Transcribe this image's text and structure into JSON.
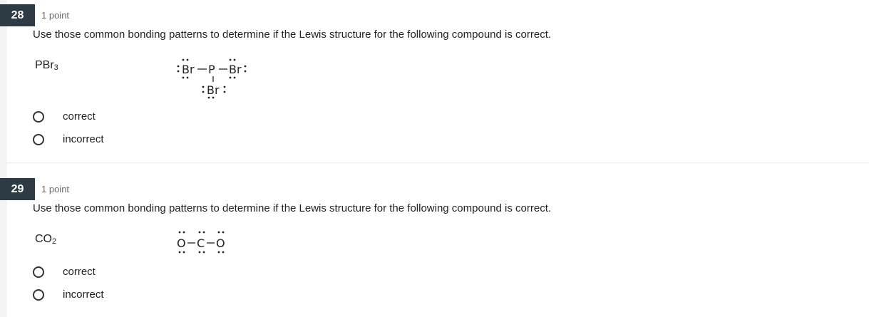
{
  "questions": [
    {
      "number": "28",
      "points": "1 point",
      "prompt": "Use those common bonding patterns to determine if the Lewis structure for the following compound is correct.",
      "formula_main": "PBr",
      "formula_sub": "3",
      "structure_atoms": [
        "Br",
        "P",
        "Br",
        "Br"
      ],
      "options": [
        {
          "label": "correct"
        },
        {
          "label": "incorrect"
        }
      ]
    },
    {
      "number": "29",
      "points": "1 point",
      "prompt": "Use those common bonding patterns to determine if the Lewis structure for the following compound is correct.",
      "formula_main": "CO",
      "formula_sub": "2",
      "structure_atoms": [
        "O",
        "C",
        "O"
      ],
      "options": [
        {
          "label": "correct"
        },
        {
          "label": "incorrect"
        }
      ]
    }
  ]
}
